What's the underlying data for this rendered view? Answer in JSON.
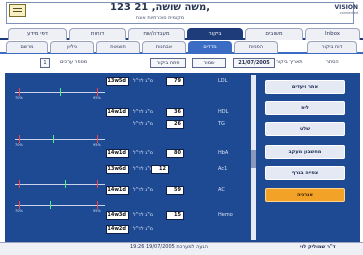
{
  "header": {
    "patient_title": "123 משה שושה, 21,",
    "patient_sub": "מקומית סוכרתיות אונח",
    "logo": "VISION",
    "logo_sub": "connected"
  },
  "tabs": [
    "Inbox",
    "משובים",
    "ביקור",
    "מעבדה/שח",
    "דוחות",
    "דפי מידע"
  ],
  "subtabs": [
    "מרשם",
    "גיליון",
    "תוצאות",
    "אבחנות",
    "מדדים",
    "הפניות",
    "דוח ביקור"
  ],
  "toolbar": {
    "hide_label": "הסתר",
    "date_label": "תאריך ביקור",
    "date_value": "21/07/2005",
    "go_label": "שמור",
    "new_label": "פתח ביקור",
    "count_label": "מספר ערכים",
    "count_value": "1"
  },
  "side_buttons": [
    "אתר ויעדים",
    "ליפ",
    "שלט",
    "מחשבון מעקב",
    "צפייה בגרף",
    "אנרגיה"
  ],
  "rows": [
    {
      "label": "מ\"ג לד\"ל",
      "value": "79",
      "left": "13w5d",
      "code": "LDL"
    },
    {
      "label": "מ\"ג לד\"ל",
      "value": "36",
      "left": "14w1d",
      "code": "HDL"
    },
    {
      "label": "מ\"ג לד\"ל",
      "value": "26",
      "left": "",
      "code": "TG"
    },
    {
      "label": "מ\"ג לד\"ל",
      "value": "80",
      "left": "14w1d",
      "code": "HbA"
    },
    {
      "label": "מ\"ג לד\"ל",
      "value": "12",
      "left": "13w6d",
      "code": "Ac1"
    },
    {
      "label": "מ\"ג לד\"ל",
      "value": "59",
      "left": "14w1d",
      "code": "AC"
    },
    {
      "label": "מ\"ג לד\"ל",
      "value": "15",
      "left": "14w3d",
      "code": "Hemo"
    },
    {
      "label": "מ\"ג לד\"ל",
      "value": "",
      "left": "14w2d",
      "code": ""
    }
  ],
  "slider": {
    "low": "70%",
    "high": "95%"
  },
  "footer": {
    "time": "19:26 19/07/2005 הגעה למערכת",
    "right": "ד\"ר שמוליק לוי"
  }
}
